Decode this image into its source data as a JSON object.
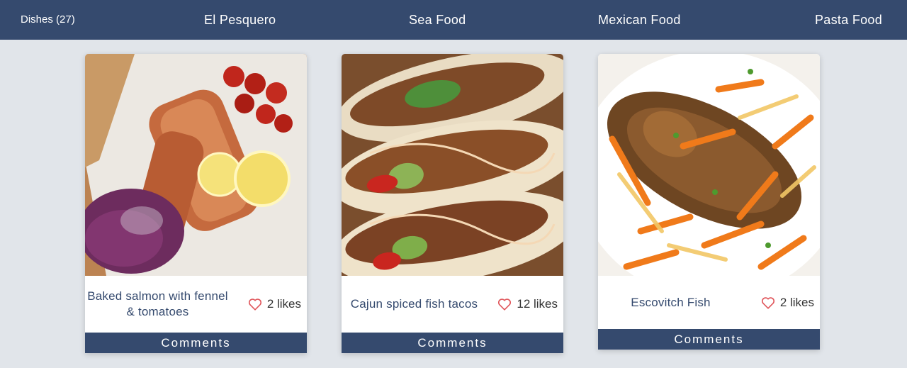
{
  "nav": {
    "count_label": "Dishes (27)",
    "links": [
      "El Pesquero",
      "Sea Food",
      "Mexican Food",
      "Pasta Food"
    ]
  },
  "cards": [
    {
      "name": "Baked salmon with fennel & tomatoes",
      "likes": "2 likes",
      "comments_label": "Comments"
    },
    {
      "name": "Cajun spiced fish tacos",
      "likes": "12 likes",
      "comments_label": "Comments"
    },
    {
      "name": "Escovitch Fish",
      "likes": "2 likes",
      "comments_label": "Comments"
    }
  ],
  "colors": {
    "navbar": "#354a6e",
    "background": "#e1e5ea",
    "heart": "#e0565b",
    "title_text": "#354a6e"
  },
  "icons": [
    "heart-icon"
  ]
}
